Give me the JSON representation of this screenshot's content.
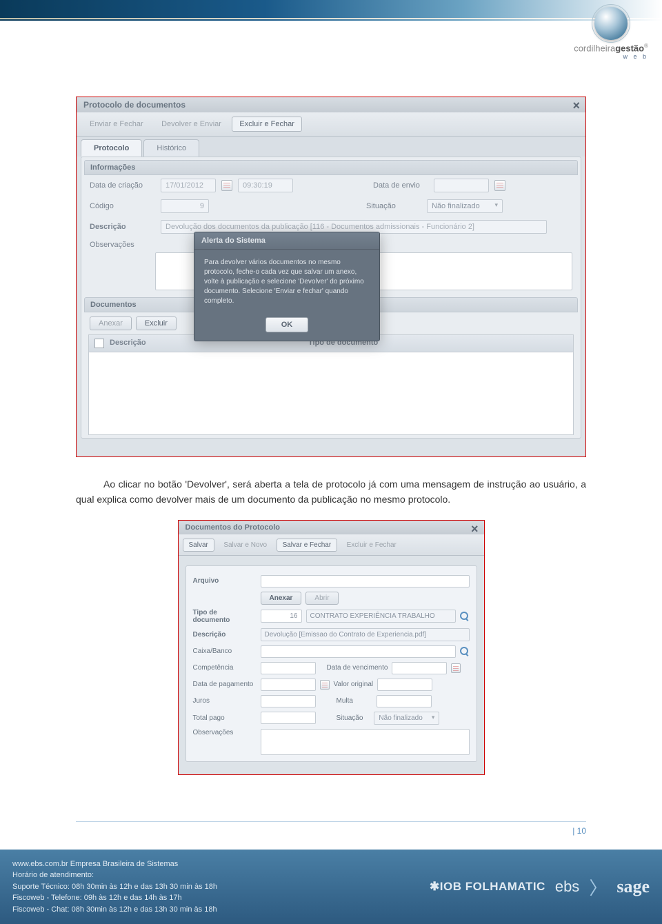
{
  "header": {
    "logo_text_light": "cordilheira",
    "logo_text_bold": "gestão",
    "logo_sub": "w e b"
  },
  "shot1": {
    "title": "Protocolo de documentos",
    "toolbar": {
      "enviar": "Enviar e Fechar",
      "devolver": "Devolver e Enviar",
      "excluir": "Excluir e Fechar"
    },
    "tabs": {
      "protocolo": "Protocolo",
      "historico": "Histórico"
    },
    "sections": {
      "info": "Informações",
      "docs": "Documentos"
    },
    "labels": {
      "data_criacao": "Data de criação",
      "data_envio": "Data de envio",
      "codigo": "Código",
      "situacao": "Situação",
      "descricao": "Descrição",
      "observacoes": "Observações"
    },
    "values": {
      "data_criacao": "17/01/2012",
      "hora_criacao": "09:30:19",
      "codigo": "9",
      "situacao": "Não finalizado",
      "descricao": "Devolução dos documentos da publicação [116 - Documentos admissionais - Funcionário 2]"
    },
    "grid": {
      "anexar": "Anexar",
      "excluir": "Excluir",
      "col_desc": "Descrição",
      "col_tipo": "Tipo de documento"
    },
    "modal": {
      "title": "Alerta do Sistema",
      "body": "Para devolver vários documentos no mesmo protocolo, feche-o cada vez que salvar um anexo, volte à publicação e selecione 'Devolver' do próximo documento. Selecione 'Enviar e fechar' quando completo.",
      "ok": "OK"
    }
  },
  "paragraph": "Ao clicar no botão 'Devolver', será aberta a tela de protocolo já com uma mensagem de instrução ao usuário, a qual explica como devolver mais de um documento da publicação no mesmo protocolo.",
  "shot2": {
    "title": "Documentos do Protocolo",
    "toolbar": {
      "salvar": "Salvar",
      "salvar_novo": "Salvar e Novo",
      "salvar_fechar": "Salvar e Fechar",
      "excluir_fechar": "Excluir e Fechar"
    },
    "labels": {
      "arquivo": "Arquivo",
      "anexar": "Anexar",
      "abrir": "Abrir",
      "tipo": "Tipo de documento",
      "descricao": "Descrição",
      "caixa": "Caixa/Banco",
      "competencia": "Competência",
      "data_venc": "Data de vencimento",
      "data_pag": "Data de pagamento",
      "valor_orig": "Valor original",
      "juros": "Juros",
      "multa": "Multa",
      "total": "Total pago",
      "situacao": "Situação",
      "obs": "Observações"
    },
    "values": {
      "tipo_code": "16",
      "tipo_text": "CONTRATO EXPERIÊNCIA  TRABALHO",
      "descricao": "Devolução [Emissao do Contrato de Experiencia.pdf]",
      "situacao": "Não finalizado"
    }
  },
  "page_number": "| 10",
  "footer": {
    "line1": "www.ebs.com.br Empresa Brasileira de Sistemas",
    "line2": "Horário de atendimento:",
    "line3": "Suporte Técnico: 08h 30min às 12h e das 13h 30 min às 18h",
    "line4": "Fiscoweb - Telefone: 09h às 12h e das 14h às 17h",
    "line5": "Fiscoweb - Chat: 08h 30min às 12h e das 13h 30 min às 18h",
    "brand_iob": "✱IOB FOLHAMATIC",
    "brand_ebs": "ebs",
    "brand_sage": "sage"
  }
}
